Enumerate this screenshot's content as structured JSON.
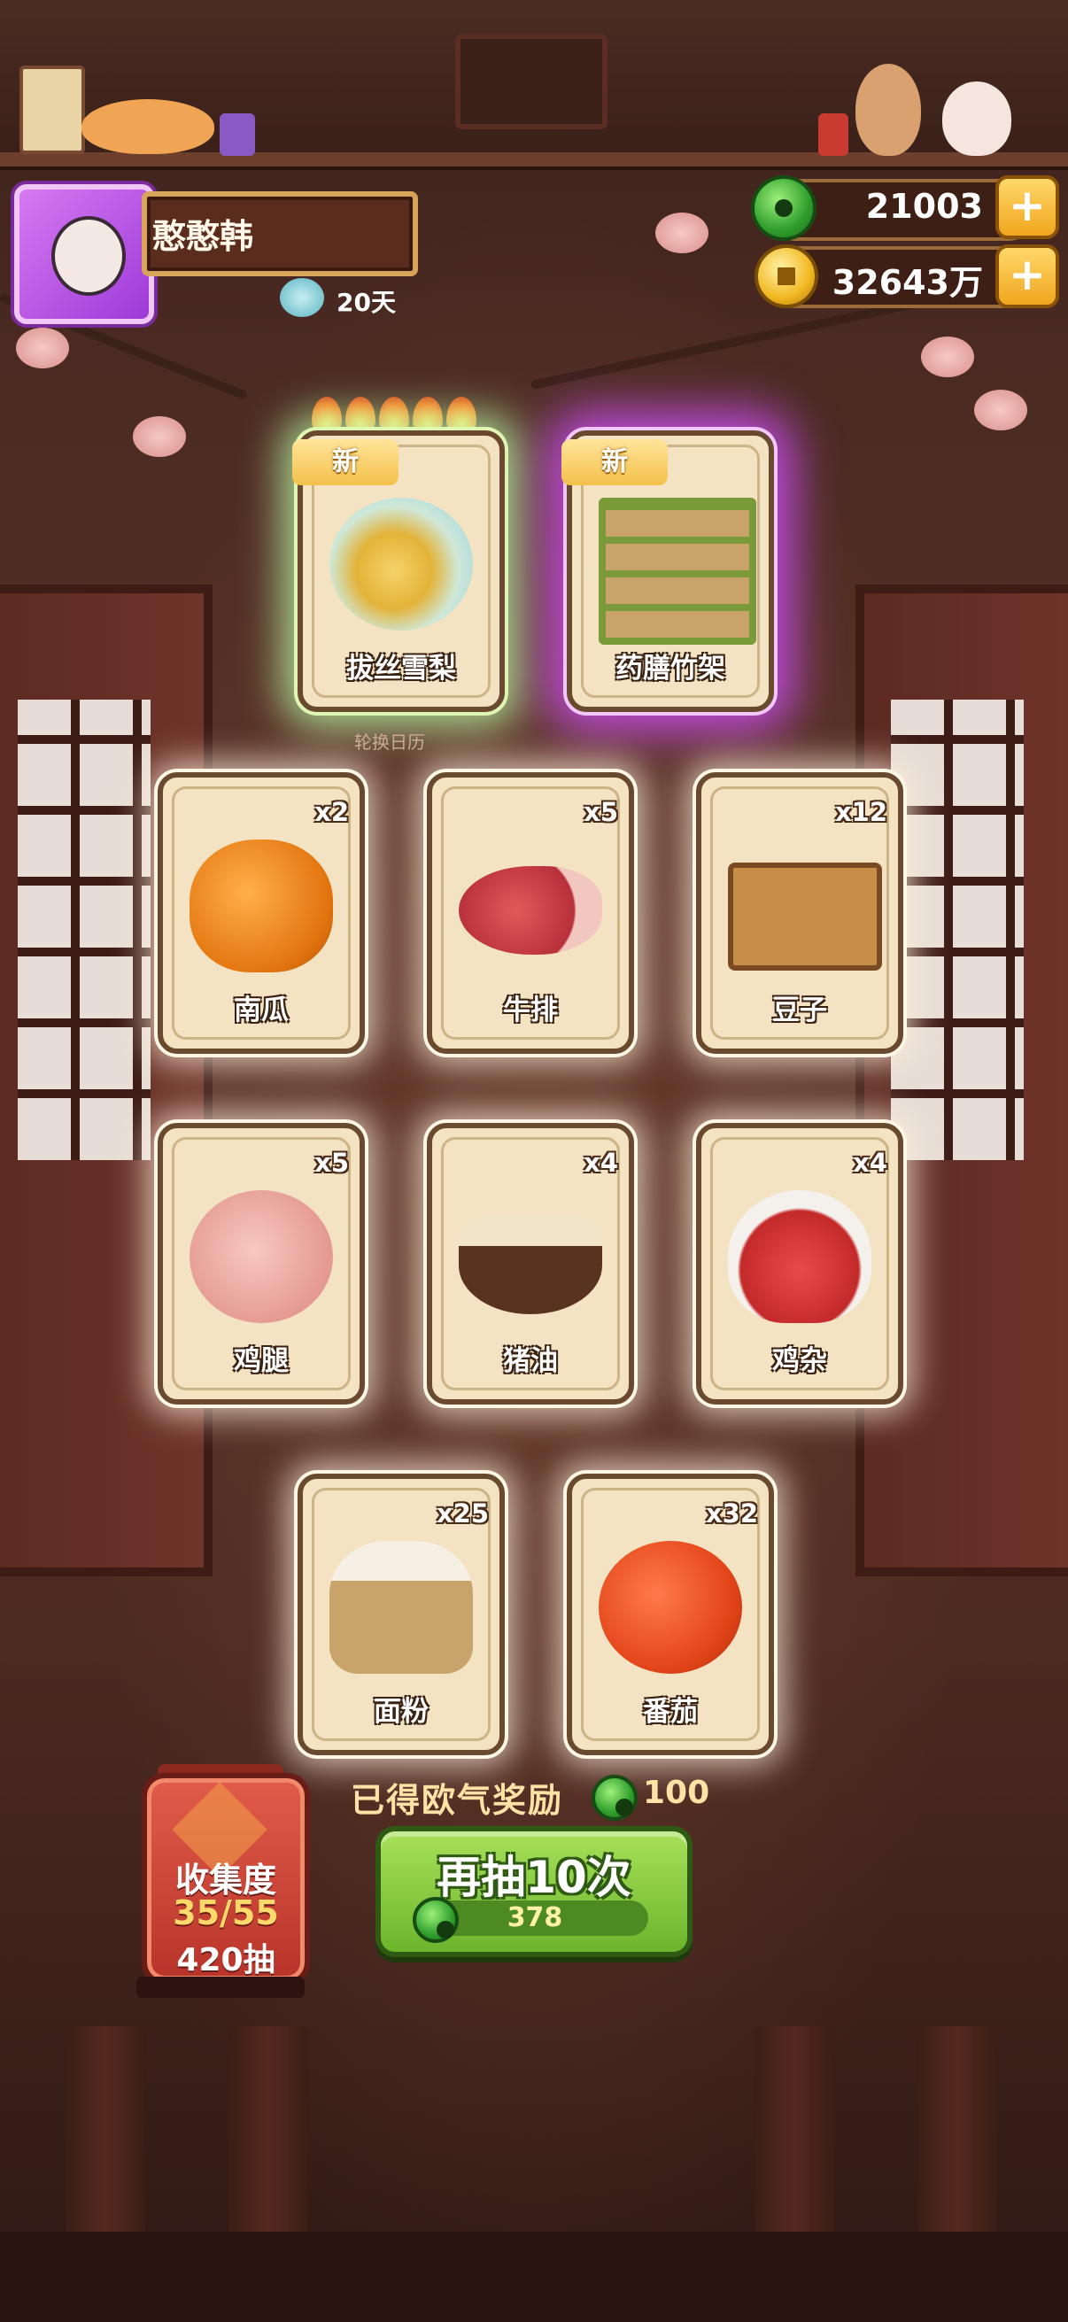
{
  "player": {
    "name": "憨憨韩",
    "days": "20天"
  },
  "currency": {
    "jade": "21003",
    "coins": "32643万"
  },
  "featured": [
    {
      "label": "拔丝雪梨",
      "tag": "新"
    },
    {
      "label": "药膳竹架",
      "tag": "新"
    }
  ],
  "calendar_label": "轮换日历",
  "items": [
    {
      "label": "南瓜",
      "qty": "x2"
    },
    {
      "label": "牛排",
      "qty": "x5"
    },
    {
      "label": "豆子",
      "qty": "x12"
    },
    {
      "label": "鸡腿",
      "qty": "x5"
    },
    {
      "label": "猪油",
      "qty": "x4"
    },
    {
      "label": "鸡杂",
      "qty": "x4"
    },
    {
      "label": "面粉",
      "qty": "x25"
    },
    {
      "label": "番茄",
      "qty": "x32"
    }
  ],
  "reward": {
    "text": "已得欧气奖励",
    "value": "100"
  },
  "draw_button": {
    "label": "再抽10次",
    "cost": "378"
  },
  "collection": {
    "title": "收集度",
    "progress": "35/55",
    "draws": "420抽"
  },
  "colors": {
    "accent_green": "#6cb52c",
    "card_bg": "#f3e3c2",
    "brown": "#5a2c1e"
  }
}
